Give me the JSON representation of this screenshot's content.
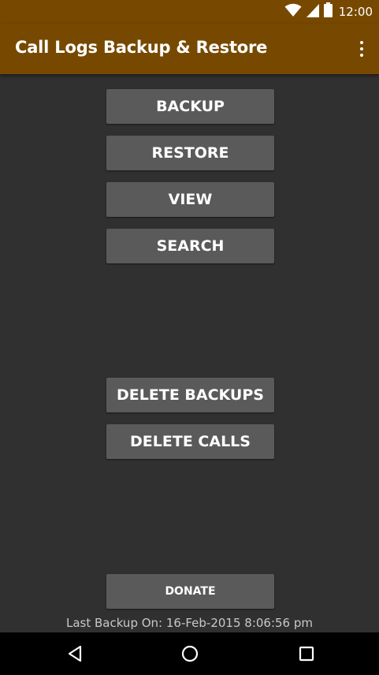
{
  "status_bar": {
    "time": "12:00",
    "icons": [
      "wifi-icon",
      "signal-icon",
      "battery-icon"
    ]
  },
  "app_bar": {
    "title": "Call Logs Backup & Restore",
    "overflow_icon": "more-vert-icon"
  },
  "buttons": {
    "backup": "BACKUP",
    "restore": "RESTORE",
    "view": "VIEW",
    "search": "SEARCH",
    "delete_backups": "DELETE BACKUPS",
    "delete_calls": "DELETE CALLS",
    "donate": "DONATE"
  },
  "footer": {
    "last_backup": "Last Backup On: 16-Feb-2015 8:06:56 pm"
  },
  "nav_bar": {
    "icons": [
      "back-icon",
      "home-icon",
      "recents-icon"
    ]
  },
  "colors": {
    "app_bar": "#774900",
    "background": "#303030",
    "button": "#5a5a5a",
    "nav_bar": "#000000"
  }
}
